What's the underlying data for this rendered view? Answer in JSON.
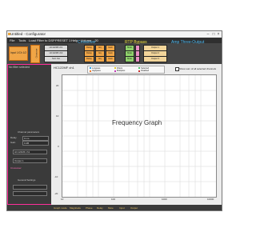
{
  "window": {
    "title": "Untitled - Configurator"
  },
  "menu": [
    "File",
    "Tools",
    "Load Filter to DSP",
    "PRESET 1",
    "Help",
    "Volume",
    "-20"
  ],
  "routing": {
    "input_label": "Input 1/Ch 1/2",
    "crossover_label": "Crossover",
    "labels": {
      "xover": "Crossover",
      "rtp": "RTP Bypass",
      "amp": "Amp Three-Output"
    },
    "channels": [
      {
        "name": "HC122MF ch1",
        "delay": "Delay",
        "eq": "Eq",
        "gain": "Gain",
        "mute": "Mute",
        "out": "Output 1"
      },
      {
        "name": "HC122MF ch2",
        "delay": "Delay",
        "eq": "Eq",
        "gain": "Gain",
        "mute": "Mute",
        "out": "Output 2"
      },
      {
        "name": "SLC Out",
        "delay": "Delay",
        "eq": "Eq",
        "gain": "Gain",
        "mute": "Mute",
        "out": "Output 3"
      }
    ]
  },
  "sidebar": {
    "heading": "No filter selected",
    "channel_title": "Channel parameters",
    "delay": "0 ms",
    "gain": "0 dB",
    "channel_name": "HC122MF ch1",
    "output_select": "Output 1",
    "crossover": "Crossover",
    "general": "General Settings"
  },
  "graph": {
    "title": "HC122MF ch1",
    "show_label": "Show sum of all selected channels",
    "placeholder": "Frequency Graph",
    "legend": [
      {
        "label": "Lowpass",
        "color": "#2f9fe0"
      },
      {
        "label": "Highpass",
        "color": "#f07b2c"
      },
      {
        "label": "Filters",
        "color": "#e0c92f"
      },
      {
        "label": "Multiples",
        "color": "#c23bb7"
      },
      {
        "label": "Selected",
        "color": "#4cc26b"
      },
      {
        "label": "Disabled",
        "color": "#c52a2a"
      }
    ],
    "y_ticks": [
      "20",
      "10",
      "0",
      "-10",
      "-20"
    ],
    "x_ticks": [
      "10",
      "100",
      "1000",
      "10000"
    ]
  },
  "status": [
    "Graph mode",
    "Magnitude",
    "Phase",
    "Delay",
    "Mute",
    "Input",
    "Output"
  ]
}
